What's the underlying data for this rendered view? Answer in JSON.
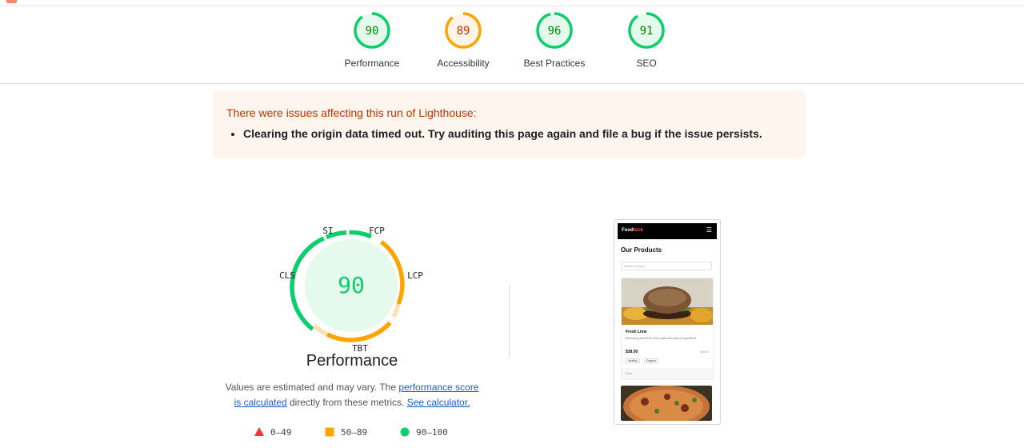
{
  "scores": [
    {
      "label": "Performance",
      "value": "90",
      "status": "pass"
    },
    {
      "label": "Accessibility",
      "value": "89",
      "status": "average"
    },
    {
      "label": "Best Practices",
      "value": "96",
      "status": "pass"
    },
    {
      "label": "SEO",
      "value": "91",
      "status": "pass"
    }
  ],
  "colors": {
    "pass": "#0cce6b",
    "pass_text": "#008800",
    "pass_bg": "#e6f9ed",
    "average": "#ffa400",
    "average_text": "#c33300",
    "average_bg": "#fff4e5",
    "fail": "#ff3333"
  },
  "warning": {
    "heading": "There were issues affecting this run of Lighthouse:",
    "items": [
      "Clearing the origin data timed out. Try auditing this page again and file a bug if the issue persists."
    ]
  },
  "performance": {
    "score": "90",
    "title": "Performance",
    "score_fraction": 0.9,
    "metrics": {
      "si": "SI",
      "fcp": "FCP",
      "lcp": "LCP",
      "tbt": "TBT",
      "cls": "CLS"
    },
    "desc_prefix": "Values are estimated and may vary. The ",
    "desc_link1": "performance score is calculated",
    "desc_middle": " directly from these metrics. ",
    "desc_link2": "See calculator."
  },
  "legend": [
    {
      "range": "0–49",
      "shape": "triangle-icon"
    },
    {
      "range": "50–89",
      "shape": "square-icon"
    },
    {
      "range": "90–100",
      "shape": "circle-icon"
    }
  ],
  "screenshot": {
    "brand_main": "Food",
    "brand_accent": "tuck",
    "menu_icon": "hamburger-icon",
    "title": "Our Products",
    "search_placeholder": "Search products...",
    "product_name": "Fresh Lime",
    "product_desc": "Refreshing fresh lime drink made with natural ingredients.",
    "price": "$38.00",
    "old_price": "$45.00",
    "tag1": "Healthy",
    "tag2": "Regular",
    "footer": "Drink"
  }
}
